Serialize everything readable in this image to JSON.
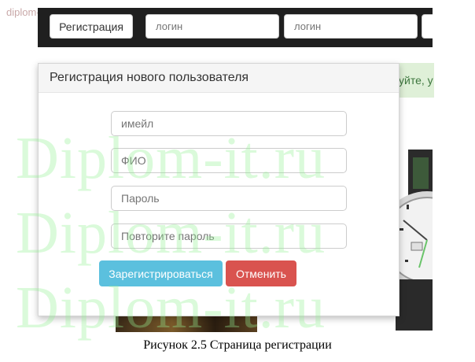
{
  "watermark_site": "diplom-it.ru",
  "navbar": {
    "register_label": "Регистрация",
    "login_placeholder_1": "логин",
    "login_placeholder_2": "логин"
  },
  "info_strip": {
    "text": "уйте, у"
  },
  "modal": {
    "title": "Регистрация нового пользователя",
    "email_placeholder": "имейл",
    "fio_placeholder": "ФИО",
    "password_placeholder": "Пароль",
    "password_repeat_placeholder": "Повторите пароль",
    "register_button": "Зарегистрироваться",
    "cancel_button": "Отменить"
  },
  "watermark_big": "Diplom-it.ru",
  "caption": "Рисунок 2.5 Страница регистрации",
  "colors": {
    "navbar_bg": "#1f1f1f",
    "register_btn": "#5bc0de",
    "cancel_btn": "#d9534f",
    "info_strip_bg": "#dff0d8"
  }
}
